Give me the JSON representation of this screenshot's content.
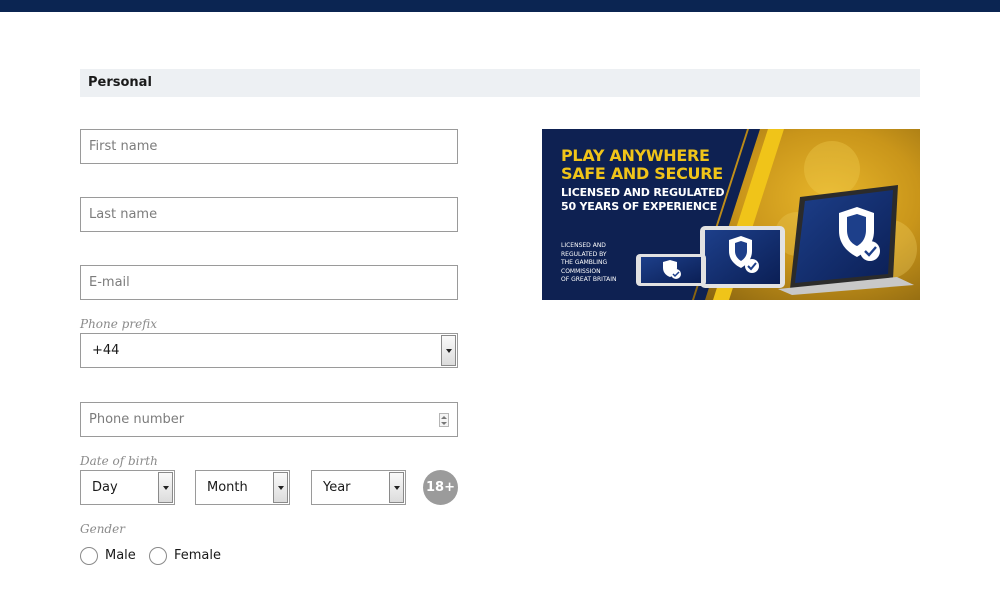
{
  "section": {
    "title": "Personal"
  },
  "fields": {
    "first_name": {
      "placeholder": "First name"
    },
    "last_name": {
      "placeholder": "Last name"
    },
    "email": {
      "placeholder": "E-mail"
    },
    "phone_prefix": {
      "label": "Phone prefix",
      "value": "+44"
    },
    "phone_number": {
      "placeholder": "Phone number"
    }
  },
  "dob": {
    "label": "Date of birth",
    "day": "Day",
    "month": "Month",
    "year": "Year",
    "age_badge": "18+"
  },
  "gender": {
    "label": "Gender",
    "options": [
      "Male",
      "Female"
    ]
  },
  "banner": {
    "line1": "PLAY ANYWHERE",
    "line2": "SAFE AND SECURE",
    "line3": "LICENSED AND REGULATED",
    "line4": "50 YEARS OF EXPERIENCE",
    "small1": "LICENSED AND",
    "small2": "REGULATED BY",
    "small3": "THE GAMBLING",
    "small4": "COMMISSION",
    "small5": "OF GREAT BRITAIN"
  },
  "colors": {
    "topbar": "#0b2552",
    "banner_navy": "#0e2152",
    "banner_gold": "#f0c419"
  }
}
